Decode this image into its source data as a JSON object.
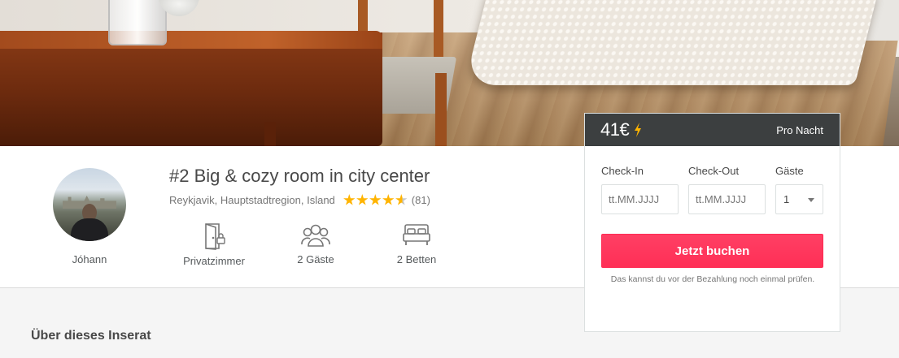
{
  "listing": {
    "title": "#2 Big & cozy room in city center",
    "location": "Reykjavik, Hauptstadtregion, Island",
    "rating": 4.5,
    "rating_max": 5,
    "review_count": "(81)"
  },
  "host": {
    "name": "Jóhann"
  },
  "features": [
    {
      "icon": "private-room-icon",
      "label": "Privatzimmer"
    },
    {
      "icon": "guests-icon",
      "label": "2 Gäste"
    },
    {
      "icon": "bed-icon",
      "label": "2 Betten"
    }
  ],
  "booking": {
    "price": "41€",
    "price_icon": "instant-book-bolt-icon",
    "per_night": "Pro Nacht",
    "checkin_label": "Check-In",
    "checkout_label": "Check-Out",
    "guests_label": "Gäste",
    "checkin_placeholder": "tt.MM.JJJJ",
    "checkout_placeholder": "tt.MM.JJJJ",
    "guests_value": "1",
    "book_button": "Jetzt buchen",
    "note": "Das kannst du vor der Bezahlung noch einmal prüfen."
  },
  "section": {
    "about_title": "Über dieses Inserat"
  },
  "colors": {
    "primary_button": "#ff385c",
    "star": "#ffb400",
    "header_dark": "#3c3f40",
    "bolt": "#ffb400"
  }
}
